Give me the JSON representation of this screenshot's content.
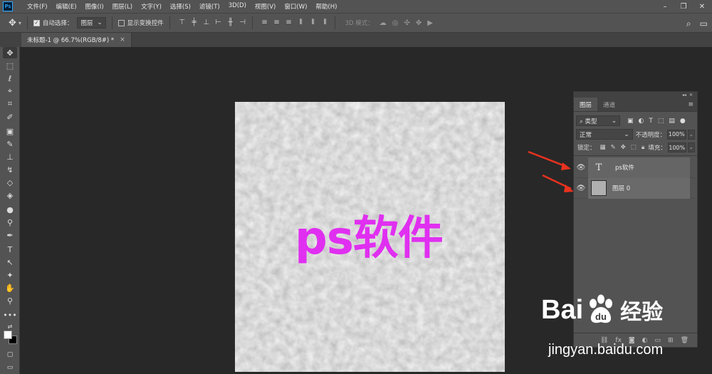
{
  "app": {
    "logo_text": "Ps",
    "menus": [
      "文件(F)",
      "编辑(E)",
      "图像(I)",
      "图层(L)",
      "文字(Y)",
      "选择(S)",
      "滤镜(T)",
      "3D(D)",
      "视图(V)",
      "窗口(W)",
      "帮助(H)"
    ]
  },
  "options": {
    "auto_select_label": "自动选择：",
    "auto_select_target": "图层",
    "show_transform_label": "显示变换控件",
    "mode_3d_label": "3D 模式："
  },
  "document": {
    "tab_title": "未标题-1 @ 66.7%(RGB/8#) *",
    "canvas_text": "ps软件",
    "canvas_text_color": "#e02ff0"
  },
  "layers_panel": {
    "tabs": [
      "图层",
      "通道"
    ],
    "filter_label": "类型",
    "blend_mode": "正常",
    "opacity_label": "不透明度：",
    "opacity_value": "100%",
    "lock_label": "锁定：",
    "fill_label": "填充：",
    "fill_value": "100%",
    "layers": [
      {
        "type": "text",
        "thumb": "T",
        "name": "ps软件"
      },
      {
        "type": "raster",
        "name": "图层 0"
      }
    ]
  },
  "watermark": {
    "brand_a": "Bai",
    "brand_b": "经验",
    "url": "jingyan.baidu.com"
  },
  "colors": {
    "accent_arrow": "#e8321e",
    "foreground": "#ffffff",
    "background": "#000000"
  }
}
